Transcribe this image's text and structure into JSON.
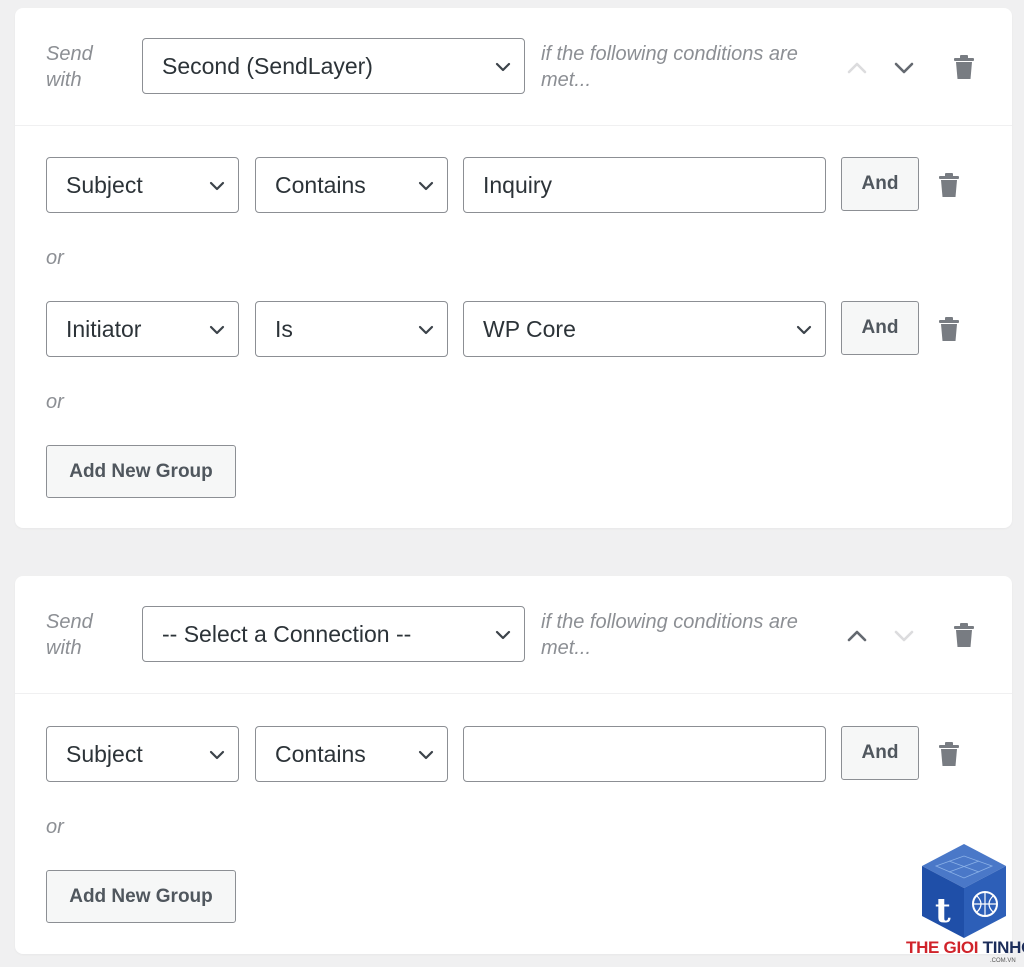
{
  "rules": [
    {
      "send_with_label": "Send with",
      "connection": "Second (SendLayer)",
      "conditions_hint": "if the following conditions are met...",
      "conditions": [
        {
          "field": "Subject",
          "operator": "Contains",
          "value": "Inquiry",
          "value_type": "text",
          "and_label": "And"
        },
        {
          "field": "Initiator",
          "operator": "Is",
          "value": "WP Core",
          "value_type": "select",
          "and_label": "And"
        }
      ],
      "or_label": "or",
      "add_group_label": "Add New Group"
    },
    {
      "send_with_label": "Send with",
      "connection": "-- Select a Connection --",
      "conditions_hint": "if the following conditions are met...",
      "conditions": [
        {
          "field": "Subject",
          "operator": "Contains",
          "value": "",
          "value_type": "text",
          "and_label": "And"
        }
      ],
      "or_label": "or",
      "add_group_label": "Add New Group"
    }
  ],
  "icons": {
    "move_up": "chevron-up-icon",
    "move_down": "chevron-down-icon",
    "delete": "trash-icon"
  },
  "colors": {
    "background": "#f0f0f1",
    "card": "#ffffff",
    "border": "#8c8f94",
    "muted_text": "#8c8f94",
    "button_bg": "#f6f7f7",
    "trash": "#787c82"
  },
  "watermark": {
    "brand_red": "THE GIOI",
    "brand_dark": "TINHOC",
    "domain": ".COM.VN"
  }
}
